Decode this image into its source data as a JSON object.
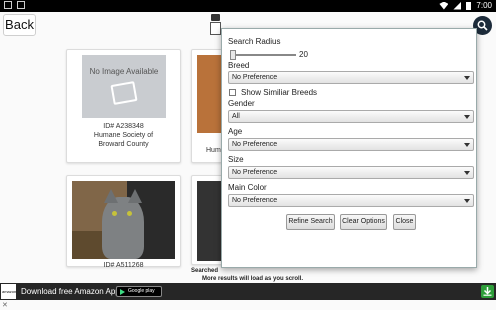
{
  "status_bar": {
    "time": "7:00"
  },
  "toolbar": {
    "back_label": "Back"
  },
  "cards": [
    {
      "noimage_text": "No Image Available",
      "id": "ID# A238348",
      "shelter": "Humane Society of Broward County"
    },
    {
      "peek_text": "Hum"
    },
    {
      "id": "ID# A511268"
    }
  ],
  "footer": {
    "searched_text": "Searched",
    "more_text": "More results will load as you scroll."
  },
  "search_panel": {
    "radius_label": "Search Radius",
    "radius_value": "20",
    "breed_label": "Breed",
    "breed_value": "No Preference",
    "similar_label": "Show Similiar Breeds",
    "gender_label": "Gender",
    "gender_value": "All",
    "age_label": "Age",
    "age_value": "No Preference",
    "size_label": "Size",
    "size_value": "No Preference",
    "color_label": "Main Color",
    "color_value": "No Preference",
    "refine_label": "Refine Search",
    "clear_label": "Clear Options",
    "close_label": "Close"
  },
  "ad": {
    "brand": "amazon",
    "text": "Download free Amazon App",
    "store": "Google play",
    "close": "✕"
  }
}
